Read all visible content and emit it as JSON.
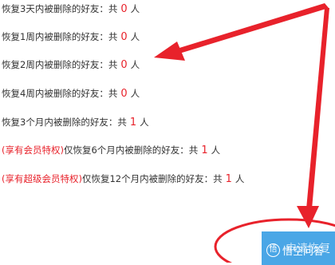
{
  "rows": [
    {
      "label": "恢复3天内被删除的好友：共",
      "count": "0",
      "unit": "人"
    },
    {
      "label": "恢复1周内被删除的好友：共",
      "count": "0",
      "unit": "人"
    },
    {
      "label": "恢复2周内被删除的好友：共",
      "count": "0",
      "unit": "人"
    },
    {
      "label": "恢复4周内被删除的好友：共",
      "count": "0",
      "unit": "人"
    },
    {
      "label": "恢复3个月内被删除的好友：共",
      "count": "1",
      "unit": "人"
    },
    {
      "privilege": "(享有会员特权)",
      "label": "仅恢复6个月内被删除的好友：共",
      "count": "1",
      "unit": "人"
    },
    {
      "privilege": "(享有超级会员特权)",
      "label": "仅恢复12个月内被删除的好友：共",
      "count": "1",
      "unit": "人"
    }
  ],
  "apply_button": {
    "label": "申请恢复"
  },
  "watermark": {
    "badge": "悟",
    "text": "悟空问答"
  },
  "colors": {
    "count": "#e8222b",
    "privilege": "#e8222b",
    "button": "#4aa7e6",
    "annotation": "#e8222b"
  }
}
